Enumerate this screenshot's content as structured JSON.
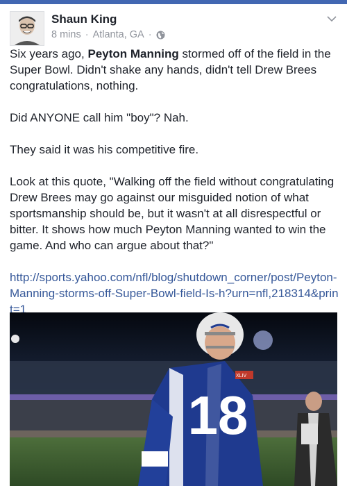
{
  "post": {
    "author": "Shaun King",
    "time": "8 mins",
    "location": "Atlanta, GA",
    "separator": "·",
    "paragraph1_before": "Six years ago, ",
    "paragraph1_bold": "Peyton Manning",
    "paragraph1_after": " stormed off of the field in the Super Bowl. Didn't shake any hands, didn't tell Drew Brees congratulations, nothing.",
    "paragraph2": "Did ANYONE call him \"boy\"? Nah.",
    "paragraph3": "They said it was his competitive fire.",
    "paragraph4": "Look at this quote, \"Walking off the field without congratulating Drew Brees may go against our misguided notion of what sportsmanship should be, but it wasn't at all disrespectful or bitter. It shows how much Peyton Manning wanted to win the game. And who can argue about that?\"",
    "link": "http://sports.yahoo.com/nfl/blog/shutdown_corner/post/Peyton-Manning-storms-off-Super-Bowl-field-Is-h?urn=nfl,218314&print=1",
    "photo_jersey_number": "18"
  },
  "icons": {
    "globe": "globe-icon",
    "menu": "chevron-down-icon"
  },
  "colors": {
    "link": "#365899",
    "meta": "#90949c",
    "jersey": "#1f3a8f"
  }
}
